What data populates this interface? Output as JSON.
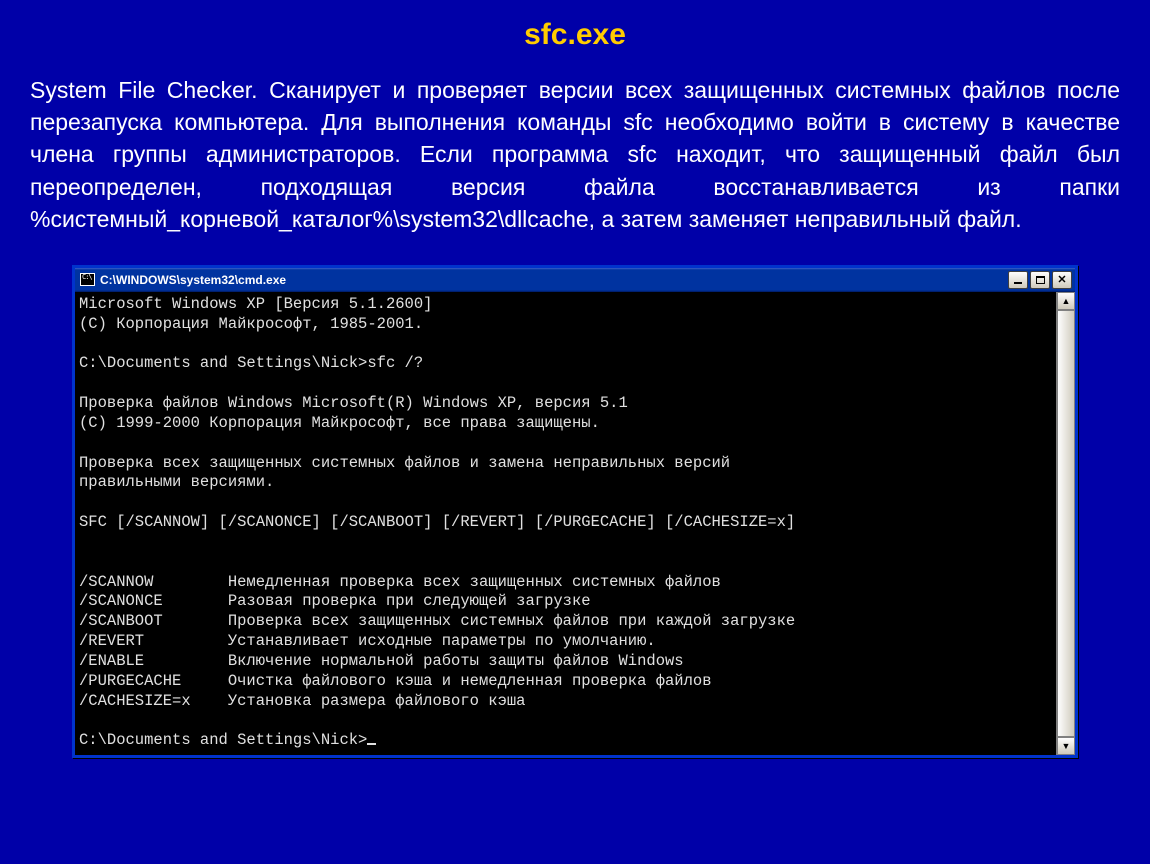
{
  "title": "sfc.exe",
  "description": "System File Checker. Сканирует и проверяет версии всех защищенных системных файлов после перезапуска компьютера. Для выполнения команды sfc необходимо войти в систему в качестве члена группы администраторов. Если программа sfc находит, что защищенный файл был переопределен, подходящая версия файла восстанавливается из папки %системный_корневой_каталог%\\system32\\dllcache, а затем заменяет неправильный файл.",
  "window": {
    "titlebar_text": "C:\\WINDOWS\\system32\\cmd.exe"
  },
  "console_lines": {
    "l0": "Microsoft Windows XP [Версия 5.1.2600]",
    "l1": "(С) Корпорация Майкрософт, 1985-2001.",
    "l2": "",
    "l3": "C:\\Documents and Settings\\Nick>sfc /?",
    "l4": "",
    "l5": "Проверка файлов Windows Microsoft(R) Windows XP, версия 5.1",
    "l6": "(C) 1999-2000 Корпорация Майкрософт, все права защищены.",
    "l7": "",
    "l8": "Проверка всех защищенных системных файлов и замена неправильных версий",
    "l9": "правильными версиями.",
    "l10": "",
    "l11": "SFC [/SCANNOW] [/SCANONCE] [/SCANBOOT] [/REVERT] [/PURGECACHE] [/CACHESIZE=x]",
    "l12": "",
    "l13": "",
    "l14": "/SCANNOW        Немедленная проверка всех защищенных системных файлов",
    "l15": "/SCANONCE       Разовая проверка при следующей загрузке",
    "l16": "/SCANBOOT       Проверка всех защищенных системных файлов при каждой загрузке",
    "l17": "/REVERT         Устанавливает исходные параметры по умолчанию.",
    "l18": "/ENABLE         Включение нормальной работы защиты файлов Windows",
    "l19": "/PURGECACHE     Очистка файлового кэша и немедленная проверка файлов",
    "l20": "/CACHESIZE=x    Установка размера файлового кэша",
    "l21": "",
    "l22": "C:\\Documents and Settings\\Nick>"
  }
}
